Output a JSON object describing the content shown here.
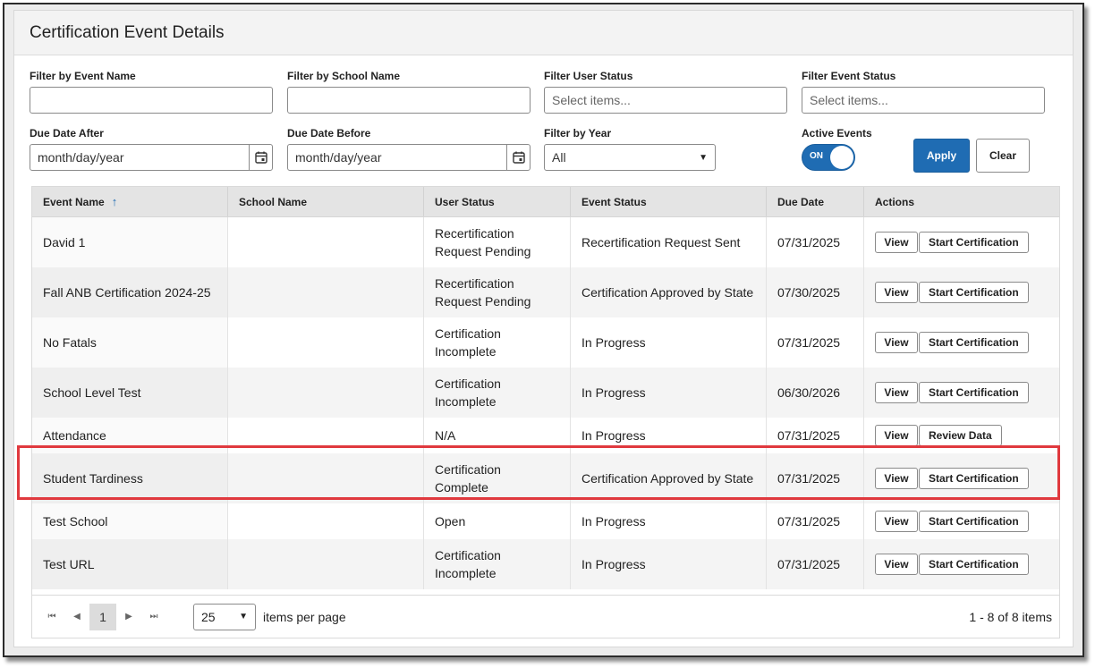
{
  "panel": {
    "title": "Certification Event Details"
  },
  "filters": {
    "event_name": {
      "label": "Filter by Event Name",
      "value": ""
    },
    "school_name": {
      "label": "Filter by School Name",
      "value": ""
    },
    "user_status": {
      "label": "Filter User Status",
      "placeholder": "Select items..."
    },
    "event_status": {
      "label": "Filter Event Status",
      "placeholder": "Select items..."
    },
    "due_after": {
      "label": "Due Date After",
      "value": "month/day/year"
    },
    "due_before": {
      "label": "Due Date Before",
      "value": "month/day/year"
    },
    "year": {
      "label": "Filter by Year",
      "value": "All"
    },
    "active": {
      "label": "Active Events",
      "state": "ON"
    },
    "apply_label": "Apply",
    "clear_label": "Clear"
  },
  "table": {
    "columns": [
      "Event Name",
      "School Name",
      "User Status",
      "Event Status",
      "Due Date",
      "Actions"
    ],
    "rows": [
      {
        "event": "David 1",
        "school": "",
        "user_status": [
          "Recertification",
          "Request Pending"
        ],
        "event_status": "Recertification Request Sent",
        "due": "07/31/2025",
        "action1": "View",
        "action2": "Start Certification"
      },
      {
        "event": "Fall ANB Certification 2024-25",
        "school": "",
        "user_status": [
          "Recertification",
          "Request Pending"
        ],
        "event_status": "Certification Approved by State",
        "due": "07/30/2025",
        "action1": "View",
        "action2": "Start Certification"
      },
      {
        "event": "No Fatals",
        "school": "",
        "user_status": [
          "Certification",
          "Incomplete"
        ],
        "event_status": "In Progress",
        "due": "07/31/2025",
        "action1": "View",
        "action2": "Start Certification"
      },
      {
        "event": "School Level Test",
        "school": "",
        "user_status": [
          "Certification",
          "Incomplete"
        ],
        "event_status": "In Progress",
        "due": "06/30/2026",
        "action1": "View",
        "action2": "Start Certification"
      },
      {
        "event": "Attendance",
        "school": "",
        "user_status": [
          "N/A",
          ""
        ],
        "event_status": "In Progress",
        "due": "07/31/2025",
        "action1": "View",
        "action2": "Review Data"
      },
      {
        "event": "Student Tardiness",
        "school": "",
        "user_status": [
          "Certification",
          "Complete"
        ],
        "event_status": "Certification Approved by State",
        "due": "07/31/2025",
        "action1": "View",
        "action2": "Start Certification"
      },
      {
        "event": "Test School",
        "school": "",
        "user_status": [
          "Open",
          ""
        ],
        "event_status": "In Progress",
        "due": "07/31/2025",
        "action1": "View",
        "action2": "Start Certification"
      },
      {
        "event": "Test URL",
        "school": "",
        "user_status": [
          "Certification",
          "Incomplete"
        ],
        "event_status": "In Progress",
        "due": "07/31/2025",
        "action1": "View",
        "action2": "Start Certification"
      }
    ]
  },
  "pager": {
    "current_page": "1",
    "page_size": "25",
    "per_page_label": "items per page",
    "summary": "1 - 8 of 8 items"
  },
  "colors": {
    "accent": "#1f6cb3",
    "highlight": "#e0393e"
  }
}
